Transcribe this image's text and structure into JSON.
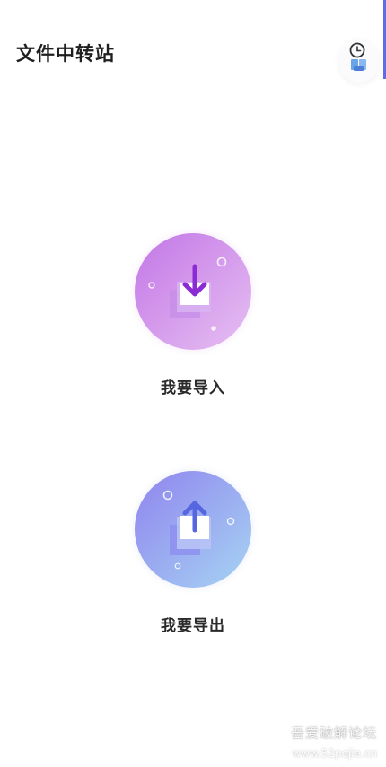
{
  "header": {
    "title": "文件中转站",
    "history_icon": "clock-document-icon"
  },
  "actions": {
    "import": {
      "label": "我要导入",
      "icon": "download-arrow-icon",
      "gradient": [
        "#c77ae8",
        "#e3b6f0"
      ]
    },
    "export": {
      "label": "我要导出",
      "icon": "upload-arrow-icon",
      "gradient": [
        "#8f8df0",
        "#a9d2f3"
      ]
    }
  },
  "watermark": {
    "text": "吾爱破解论坛",
    "url": "www.52pojie.cn"
  },
  "colors": {
    "accent": "#5b6ee8",
    "import_arrow": "#8a2bd3",
    "export_arrow": "#5566e0"
  }
}
